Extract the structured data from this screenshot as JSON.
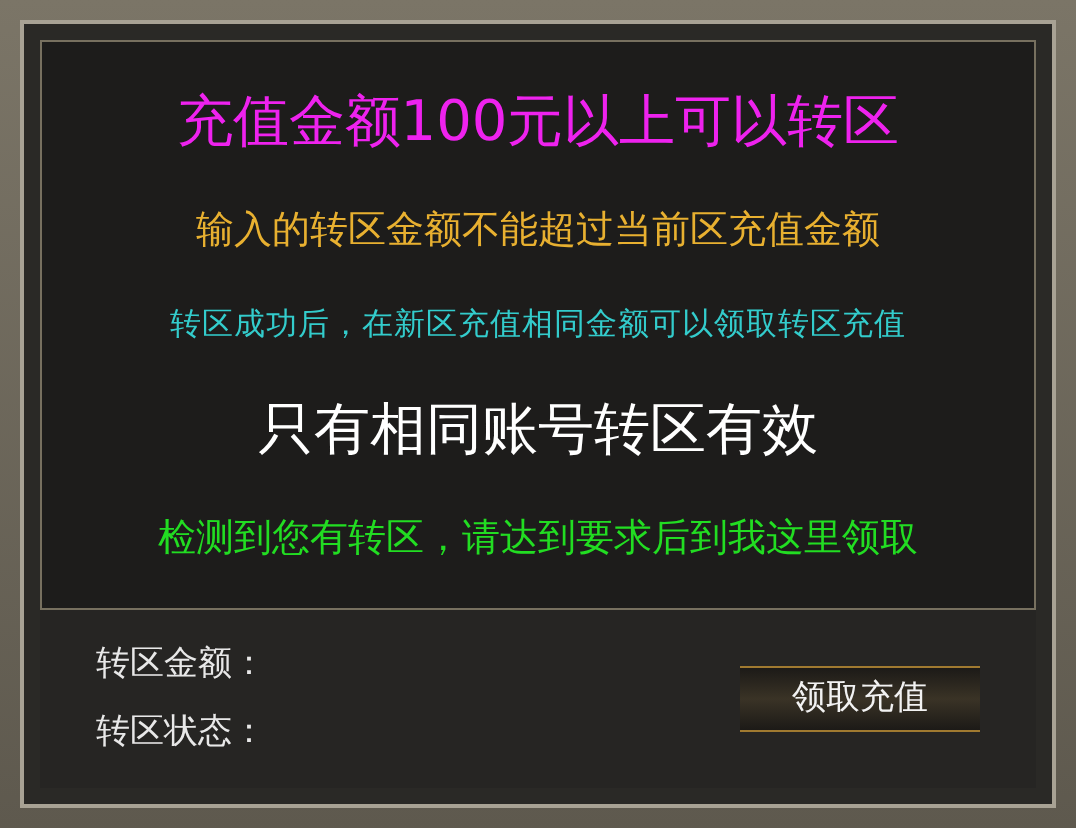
{
  "notices": [
    {
      "text": "充值金额100元以上可以转区",
      "kind": "headline",
      "color": "#ee22ee"
    },
    {
      "text": "输入的转区金额不能超过当前区充值金额",
      "kind": "note",
      "color": "#e8b030"
    },
    {
      "text": "转区成功后，在新区充值相同金额可以领取转区充值",
      "kind": "small",
      "color": "#33cccc"
    },
    {
      "text": "只有相同账号转区有效",
      "kind": "headline",
      "color": "#ffffff"
    },
    {
      "text": "检测到您有转区，请达到要求后到我这里领取",
      "kind": "note",
      "color": "#22dd22"
    }
  ],
  "fields": [
    {
      "label": "转区金额："
    },
    {
      "label": "转区状态："
    }
  ],
  "claim_button": "领取充值"
}
